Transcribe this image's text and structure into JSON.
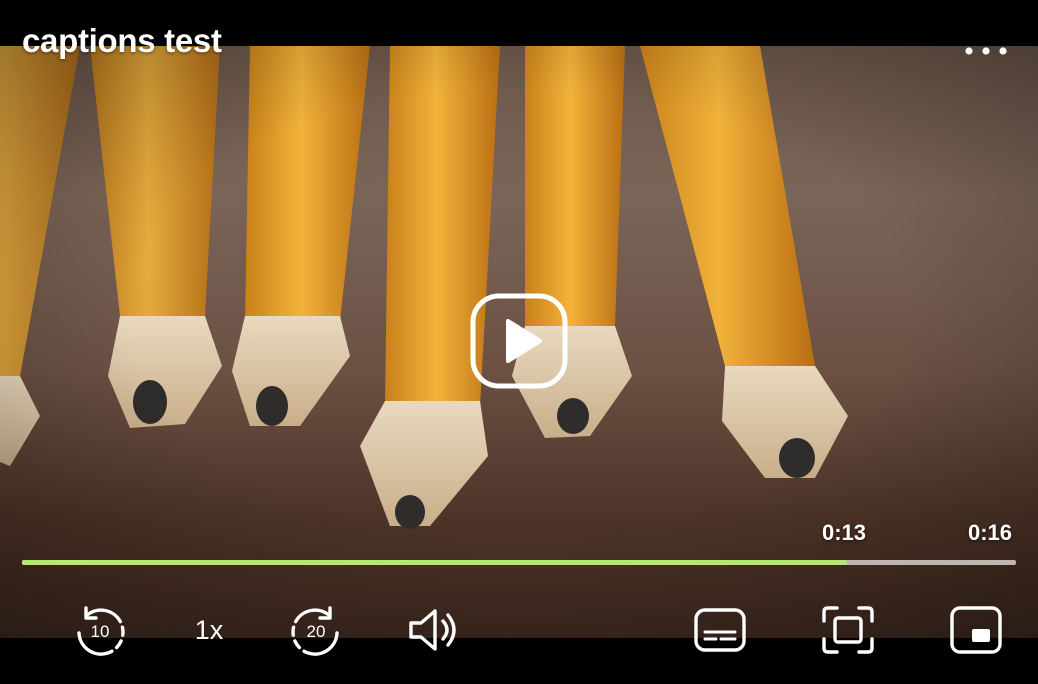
{
  "video": {
    "title": "captions test"
  },
  "playback": {
    "current_time": "0:13",
    "total_time": "0:16",
    "progress": 0.83,
    "speed": "1x"
  },
  "controls": {
    "rewind_seconds": "10",
    "forward_seconds": "20"
  },
  "colors": {
    "progress_played": "#b5e67a",
    "progress_track": "#bdb6b0",
    "controls": "#ffffff"
  },
  "icons": [
    "more-options-icon",
    "play-icon",
    "rewind-10-icon",
    "forward-20-icon",
    "volume-icon",
    "captions-icon",
    "fullscreen-icon",
    "picture-in-picture-icon"
  ]
}
